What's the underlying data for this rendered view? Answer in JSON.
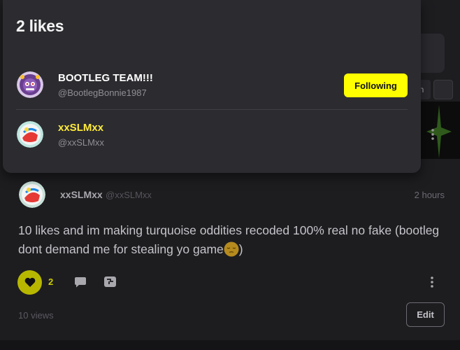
{
  "popup": {
    "title": "2 likes",
    "likers": [
      {
        "name": "BOOTLEG TEAM!!!",
        "handle": "@BootlegBonnie1987",
        "follow_label": "Following"
      },
      {
        "name": "xxSLMxx",
        "handle": "@xxSLMxx"
      }
    ]
  },
  "post": {
    "author_name": "xxSLMxx",
    "author_handle": "@xxSLMxx",
    "time": "2 hours",
    "body": "10 likes and im making turquoise oddities recoded 100% real no fake (bootleg dont demand me for stealing yo game",
    "body_end": ")",
    "like_count": "2",
    "views": "10 views",
    "edit_label": "Edit"
  },
  "colors": {
    "accent_yellow": "#ffff00",
    "popup_bg": "#2c2c30",
    "page_bg": "#18181b"
  },
  "icons": [
    "heart-icon",
    "comment-icon",
    "remix-icon",
    "more-vertical-icon",
    "pensive-face-emoji"
  ]
}
